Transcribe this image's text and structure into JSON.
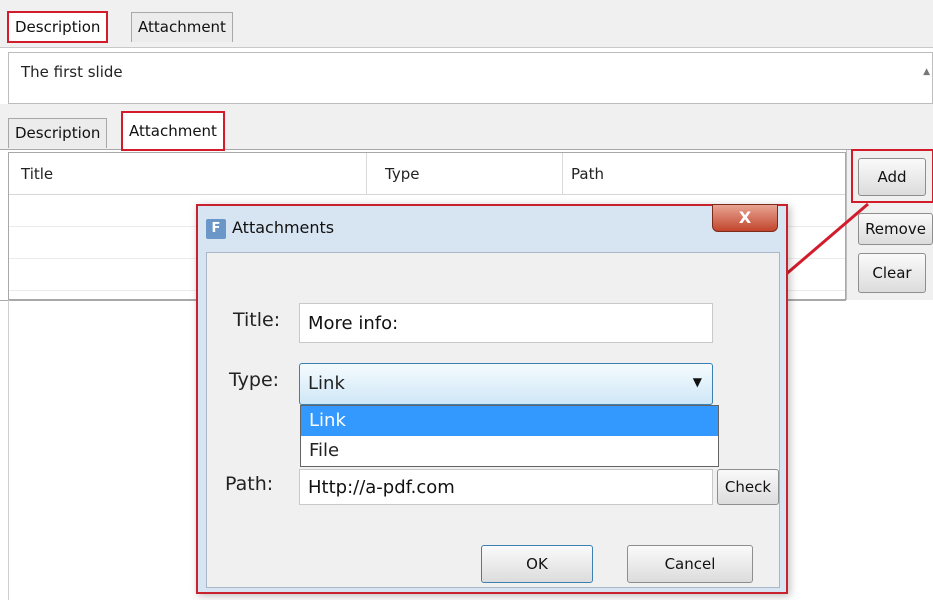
{
  "top_tabs": [
    {
      "label": "Description",
      "active": true
    },
    {
      "label": "Attachment",
      "active": false
    }
  ],
  "description_text": "The first slide",
  "second_tabs": [
    {
      "label": "Description",
      "active": false
    },
    {
      "label": "Attachment",
      "active": true
    }
  ],
  "table": {
    "columns": [
      "Title",
      "Type",
      "Path"
    ],
    "rows": []
  },
  "side_buttons": {
    "add": "Add",
    "remove": "Remove",
    "clear": "Clear"
  },
  "dialog": {
    "title": "Attachments",
    "icon_letter": "F",
    "close_glyph": "X",
    "title_label": "Title:",
    "title_value": "More info:",
    "type_label": "Type:",
    "type_selected": "Link",
    "type_options": [
      "Link",
      "File"
    ],
    "highlighted_option": "Link",
    "path_label": "Path:",
    "path_value": "Http://a-pdf.com",
    "check_label": "Check",
    "ok_label": "OK",
    "cancel_label": "Cancel"
  },
  "colors": {
    "highlight_red": "#d21c2c",
    "selection_blue": "#3399ff"
  },
  "icons": {
    "dialog_icon": "app-icon",
    "close": "close-icon",
    "combo_arrow": "chevron-down-icon",
    "annotation": "arrow-icon"
  }
}
